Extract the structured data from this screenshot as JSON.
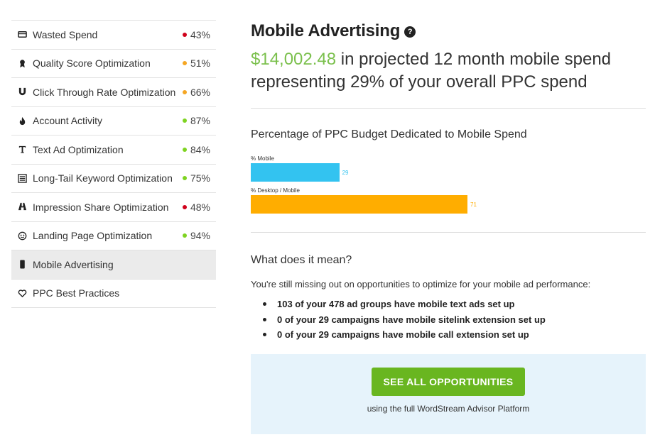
{
  "sidebar": {
    "items": [
      {
        "label": "Wasted Spend",
        "score": "43%",
        "dot_color": "#d0021b",
        "icon": "wallet-icon"
      },
      {
        "label": "Quality Score Optimization",
        "score": "51%",
        "dot_color": "#f5a623",
        "icon": "ribbon-icon"
      },
      {
        "label": "Click Through Rate Optimization",
        "score": "66%",
        "dot_color": "#f5a623",
        "icon": "magnet-icon"
      },
      {
        "label": "Account Activity",
        "score": "87%",
        "dot_color": "#7ed321",
        "icon": "flame-icon"
      },
      {
        "label": "Text Ad Optimization",
        "score": "84%",
        "dot_color": "#7ed321",
        "icon": "text-icon"
      },
      {
        "label": "Long-Tail Keyword Optimization",
        "score": "75%",
        "dot_color": "#7ed321",
        "icon": "list-icon"
      },
      {
        "label": "Impression Share Optimization",
        "score": "48%",
        "dot_color": "#d0021b",
        "icon": "binoculars-icon"
      },
      {
        "label": "Landing Page Optimization",
        "score": "94%",
        "dot_color": "#7ed321",
        "icon": "globe-icon"
      },
      {
        "label": "Mobile Advertising",
        "score": "",
        "dot_color": "",
        "icon": "mobile-icon",
        "active": true
      },
      {
        "label": "PPC Best Practices",
        "score": "",
        "dot_color": "",
        "icon": "heart-icon"
      }
    ]
  },
  "main": {
    "title": "Mobile Advertising",
    "help_icon": "?",
    "summary_amount": "$14,002.48",
    "summary_text": " in projected 12 month mobile spend representing 29% of your overall PPC spend",
    "chart_title": "Percentage of PPC Budget Dedicated to Mobile Spend",
    "meaning_title": "What does it mean?",
    "meaning_text": "You're still missing out on opportunities to optimize for your mobile ad performance:",
    "bullets": [
      "103 of your 478 ad groups have mobile text ads set up",
      "0 of your 29 campaigns have mobile sitelink extension set up",
      "0 of your 29 campaigns have mobile call extension set up"
    ],
    "cta_button": "SEE ALL OPPORTUNITIES",
    "cta_sub": "using the full WordStream Advisor Platform"
  },
  "chart_data": {
    "type": "bar",
    "orientation": "horizontal",
    "categories": [
      "% Mobile",
      "% Desktop / Mobile"
    ],
    "values": [
      29,
      71
    ],
    "colors": [
      "#33c3f0",
      "#ffad00"
    ],
    "title": "Percentage of PPC Budget Dedicated to Mobile Spend",
    "xlim": [
      0,
      100
    ]
  }
}
